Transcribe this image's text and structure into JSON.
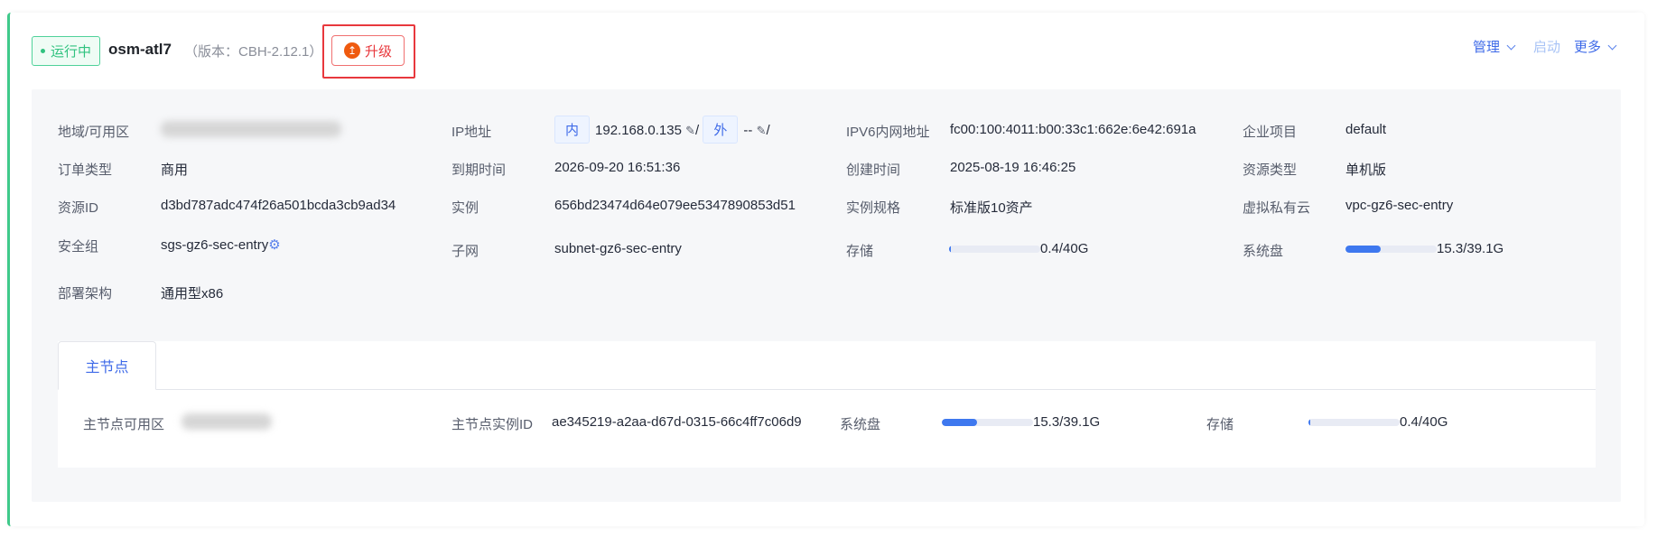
{
  "header": {
    "status": "运行中",
    "name": "osm-atl7",
    "version": "（版本：CBH-2.12.1）",
    "upgrade": "升级",
    "actions": {
      "manage": "管理",
      "start": "启动",
      "more": "更多"
    }
  },
  "colors": {
    "accent": "#3e6ae8",
    "running": "#30c27f",
    "upgrade": "#e8383d"
  },
  "info": {
    "region": {
      "label": "地域/可用区"
    },
    "ip": {
      "label": "IP地址",
      "inner_tag": "内",
      "inner": "192.168.0.135",
      "outer_tag": "外",
      "outer": "--",
      "sep": "/"
    },
    "ipv6": {
      "label": "IPV6内网地址",
      "value": "fc00:100:4011:b00:33c1:662e:6e42:691a"
    },
    "project": {
      "label": "企业项目",
      "value": "default"
    },
    "order": {
      "label": "订单类型",
      "value": "商用"
    },
    "expire": {
      "label": "到期时间",
      "value": "2026-09-20 16:51:36"
    },
    "created": {
      "label": "创建时间",
      "value": "2025-08-19 16:46:25"
    },
    "restype": {
      "label": "资源类型",
      "value": "单机版"
    },
    "resid": {
      "label": "资源ID",
      "value": "d3bd787adc474f26a501bcda3cb9ad34"
    },
    "instance": {
      "label": "实例",
      "value": "656bd23474d64e079ee5347890853d51"
    },
    "spec": {
      "label": "实例规格",
      "value": "标准版10资产"
    },
    "vpc": {
      "label": "虚拟私有云",
      "value": "vpc-gz6-sec-entry"
    },
    "sg": {
      "label": "安全组",
      "value": "sgs-gz6-sec-entry"
    },
    "subnet": {
      "label": "子网",
      "value": "subnet-gz6-sec-entry"
    },
    "storage": {
      "label": "存储",
      "value": "0.4/40G",
      "percent": 1
    },
    "sysdisk": {
      "label": "系统盘",
      "value": "15.3/39.1G",
      "percent": 39
    },
    "arch": {
      "label": "部署架构",
      "value": "通用型x86"
    }
  },
  "node": {
    "tab": "主节点",
    "az_label": "主节点可用区",
    "id_label": "主节点实例ID",
    "id": "ae345219-a2aa-d67d-0315-66c4ff7c06d9",
    "sysdisk_label": "系统盘",
    "sysdisk": "15.3/39.1G",
    "sysdisk_percent": 39,
    "storage_label": "存储",
    "storage": "0.4/40G",
    "storage_percent": 1
  }
}
